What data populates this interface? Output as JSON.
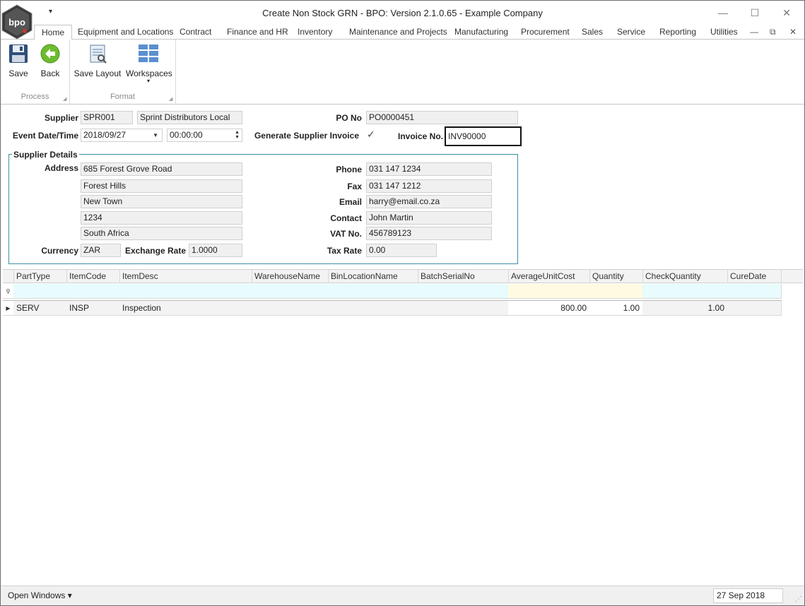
{
  "window": {
    "title": "Create Non Stock GRN - BPO: Version 2.1.0.65 - Example Company",
    "logo_text": "bpo",
    "minimize_glyph": "—",
    "maximize_glyph": "☐",
    "close_glyph": "✕",
    "qat_arrow": "▾"
  },
  "ribbon": {
    "tabs": [
      "Home",
      "Equipment and Locations",
      "Contract",
      "Finance and HR",
      "Inventory",
      "Maintenance and Projects",
      "Manufacturing",
      "Procurement",
      "Sales",
      "Service",
      "Reporting",
      "Utilities"
    ],
    "active_tab": "Home",
    "mdi_minimize": "—",
    "mdi_restore": "⧉",
    "mdi_close": "✕",
    "groups": [
      {
        "label": "Process",
        "buttons": [
          {
            "label": "Save",
            "icon": "floppy-disk-icon"
          },
          {
            "label": "Back",
            "icon": "back-arrow-icon"
          }
        ]
      },
      {
        "label": "Format",
        "buttons": [
          {
            "label": "Save Layout",
            "icon": "save-layout-icon"
          },
          {
            "label": "Workspaces",
            "icon": "workspaces-icon"
          }
        ]
      }
    ],
    "dropdown_glyph": "▾"
  },
  "form": {
    "supplier_label": "Supplier",
    "supplier_code": "SPR001",
    "supplier_name": "Sprint Distributors Local",
    "po_label": "PO No",
    "po_no": "PO0000451",
    "event_label": "Event Date/Time",
    "event_date": "2018/09/27",
    "event_time": "00:00:00",
    "gen_invoice_label": "Generate Supplier Invoice",
    "gen_invoice_checked": "✓",
    "invoice_label": "Invoice No.",
    "invoice_no": "INV90000",
    "details_title": "Supplier Details",
    "address_label": "Address",
    "address_lines": [
      "685 Forest Grove Road",
      "Forest Hills",
      "New Town",
      "1234",
      "South Africa"
    ],
    "phone_label": "Phone",
    "phone": "031 147 1234",
    "fax_label": "Fax",
    "fax": "031 147 1212",
    "email_label": "Email",
    "email": "harry@email.co.za",
    "contact_label": "Contact",
    "contact": "John Martin",
    "vat_label": "VAT No.",
    "vat": "456789123",
    "currency_label": "Currency",
    "currency": "ZAR",
    "exchange_label": "Exchange Rate",
    "exchange_rate": "1.0000",
    "taxrate_label": "Tax Rate",
    "tax_rate": "0.00"
  },
  "grid": {
    "columns": [
      "PartType",
      "ItemCode",
      "ItemDesc",
      "WarehouseName",
      "BinLocationName",
      "BatchSerialNo",
      "AverageUnitCost",
      "Quantity",
      "CheckQuantity",
      "CureDate"
    ],
    "new_row_glyph": "⚲",
    "row_glyph": "▶",
    "rows": [
      [
        "SERV",
        "INSP",
        "Inspection",
        "",
        "",
        "",
        "800.00",
        "1.00",
        "1.00",
        ""
      ]
    ]
  },
  "status": {
    "open_windows": "Open Windows ▾",
    "date": "27 Sep 2018",
    "grip": "⋰"
  }
}
